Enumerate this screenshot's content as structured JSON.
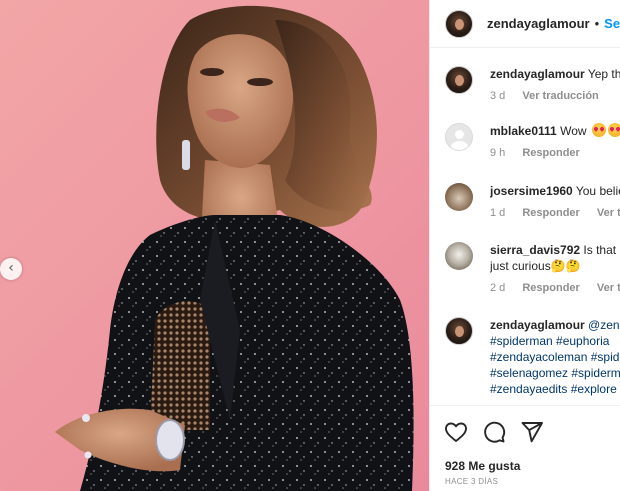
{
  "post": {
    "author": "zendayaglamour",
    "separator": "•",
    "follow_label": "Seguir",
    "carousel_prev_icon": "chevron-left-icon"
  },
  "comments": [
    {
      "user": "zendayaglamour",
      "text": "Yep that's her",
      "time": "3 d",
      "action": "Ver traducción",
      "avatar": "zendaya-avatar"
    },
    {
      "user": "mblake0111",
      "text": "Wow",
      "emojis": "heart-eyes-emoji heart-eyes-emoji",
      "time": "9 h",
      "action": "Responder",
      "avatar": "default-avatar"
    },
    {
      "user": "josersime1960",
      "text": "You believe",
      "time": "1 d",
      "action": "Responder",
      "action2": "Ver traducción",
      "avatar": "jose-avatar"
    },
    {
      "user": "sierra_davis792",
      "text": "Is that real?",
      "text2": "just curious🤔🤔",
      "time": "2 d",
      "action": "Responder",
      "action2": "Ver traducción",
      "avatar": "sierra-avatar"
    },
    {
      "user": "zendayaglamour",
      "text": "@zendaya",
      "tags": [
        "#spiderman #euphoria",
        "#zendayacoleman #spiderman",
        "#selenagomez #spiderman",
        "#zendayaedits #explore"
      ],
      "avatar": "zendaya-avatar"
    }
  ],
  "footer": {
    "like_icon": "heart-icon",
    "comment_icon": "comment-icon",
    "share_icon": "share-icon",
    "likes": "928 Me gusta",
    "time": "HACE 3 DÍAS"
  }
}
